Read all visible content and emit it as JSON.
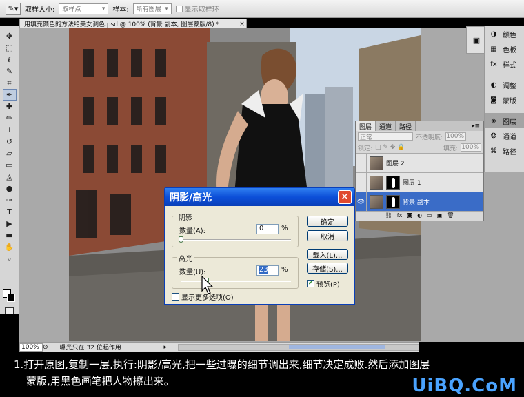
{
  "options_bar": {
    "sample_size_label": "取样大小:",
    "sample_size_value": "取样点",
    "sample_label": "样本:",
    "sample_value": "所有图层",
    "show_ring_label": "显示取样环"
  },
  "document": {
    "title": "用填充颜色的方法给美女调色.psd @ 100% (背景 副本, 图层蒙版/8) *",
    "close": "×"
  },
  "status": {
    "zoom": "100%",
    "info": "曝光只在 32 位起作用"
  },
  "dock": {
    "items": [
      {
        "label": "颜色",
        "icon": "color-icon"
      },
      {
        "label": "色板",
        "icon": "swatches-icon"
      },
      {
        "label": "样式",
        "icon": "styles-icon"
      },
      {
        "label": "调整",
        "icon": "adjustments-icon"
      },
      {
        "label": "蒙版",
        "icon": "masks-icon"
      },
      {
        "label": "图层",
        "icon": "layers-icon"
      },
      {
        "label": "通道",
        "icon": "channels-icon"
      },
      {
        "label": "路径",
        "icon": "paths-icon"
      }
    ]
  },
  "layers_panel": {
    "tabs": [
      "图层",
      "通道",
      "路径"
    ],
    "blend_mode": "正常",
    "opacity_label": "不透明度:",
    "opacity_value": "100%",
    "lock_label": "锁定:",
    "fill_label": "填充:",
    "fill_value": "100%",
    "layers": [
      {
        "name": "图层 2",
        "visible": false,
        "active": false
      },
      {
        "name": "图层 1",
        "visible": false,
        "active": false
      },
      {
        "name": "背景 副本",
        "visible": true,
        "active": true
      }
    ]
  },
  "dialog": {
    "title": "阴影/高光",
    "shadows_group": "阴影",
    "shadows_amount_label": "数量(A):",
    "shadows_amount_value": "0",
    "shadows_amount_fraction": 0.0,
    "highlights_group": "高光",
    "highlights_amount_label": "数量(U):",
    "highlights_amount_value": "23",
    "highlights_amount_fraction": 0.23,
    "percent": "%",
    "ok": "确定",
    "cancel": "取消",
    "load": "载入(L)...",
    "save": "存储(S)...",
    "preview": "预览(P)",
    "show_more": "显示更多选项(O)"
  },
  "caption": {
    "line1": "1.打开原图,复制一层,执行:阴影/高光,把一些过曝的细节调出来,细节决定成败.然后添加图层",
    "line2": "蒙版,用黑色画笔把人物擦出来。",
    "watermark": "UiBQ.CoM"
  }
}
